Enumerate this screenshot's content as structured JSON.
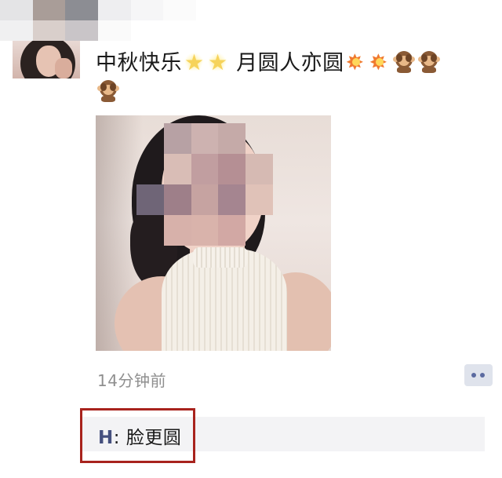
{
  "post": {
    "author_avatar_icon": "profile-photo-icon",
    "text_part1": "中秋快乐",
    "text_part2": "月圆人亦圆",
    "emojis_after_part1": [
      "glowing-star-icon",
      "glowing-star-icon"
    ],
    "emojis_after_part2": [
      "collision-icon",
      "collision-icon",
      "hear-no-evil-monkey-icon",
      "hear-no-evil-monkey-icon",
      "hear-no-evil-monkey-icon"
    ],
    "time_ago": "14分钟前",
    "comment_button_icon": "comment-dots-icon"
  },
  "comments": [
    {
      "author": "H",
      "separator": ": ",
      "text": "脸更圆"
    }
  ],
  "colors": {
    "time_text": "#8f8f8f",
    "comment_author": "#45507e",
    "comment_bg": "#f3f3f5",
    "highlight_border": "#a8231d",
    "comment_button_bg": "#dfe3ec"
  }
}
